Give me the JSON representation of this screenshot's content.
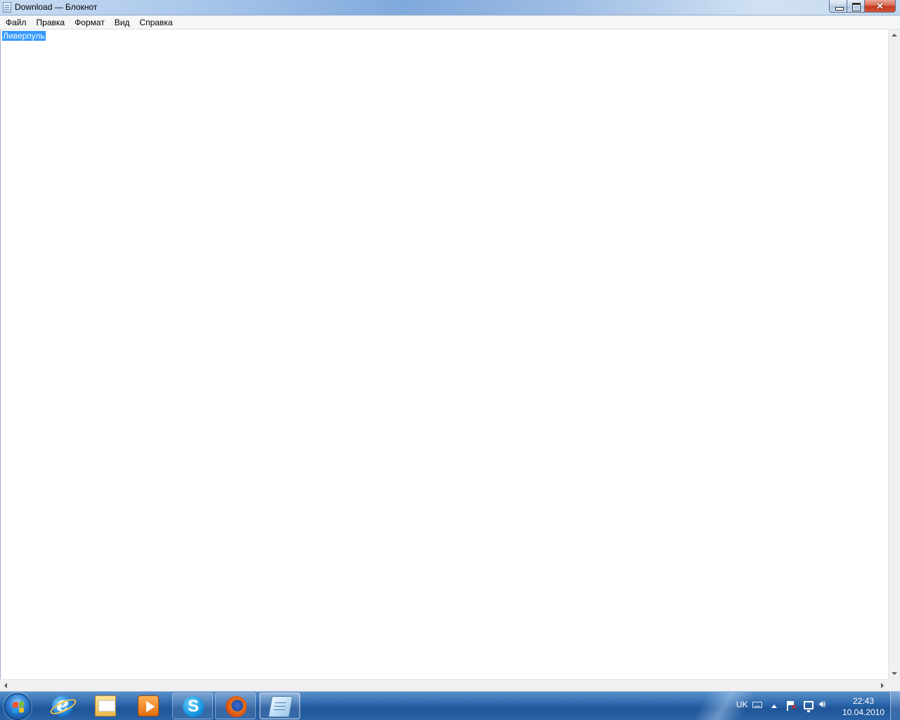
{
  "window": {
    "title": "Download — Блокнот"
  },
  "menu": {
    "items": [
      "Файл",
      "Правка",
      "Формат",
      "Вид",
      "Справка"
    ]
  },
  "editor": {
    "content": "Ливерпуль",
    "selected": true
  },
  "taskbar": {
    "pinned": [
      {
        "name": "Internet Explorer",
        "icon": "ie-icon",
        "state": "pinned"
      },
      {
        "name": "Windows Explorer",
        "icon": "folder-icon",
        "state": "pinned"
      },
      {
        "name": "Windows Media Player",
        "icon": "media-player-icon",
        "state": "pinned"
      },
      {
        "name": "Skype",
        "icon": "skype-icon",
        "state": "running"
      },
      {
        "name": "Firefox",
        "icon": "firefox-icon",
        "state": "running"
      },
      {
        "name": "Notepad",
        "icon": "notepad-icon",
        "state": "active"
      }
    ],
    "tray": {
      "language": "UK",
      "time": "22:43",
      "date": "10.04.2010"
    }
  },
  "colors": {
    "selection": "#3399ff",
    "taskbar": "#2a63a8"
  }
}
